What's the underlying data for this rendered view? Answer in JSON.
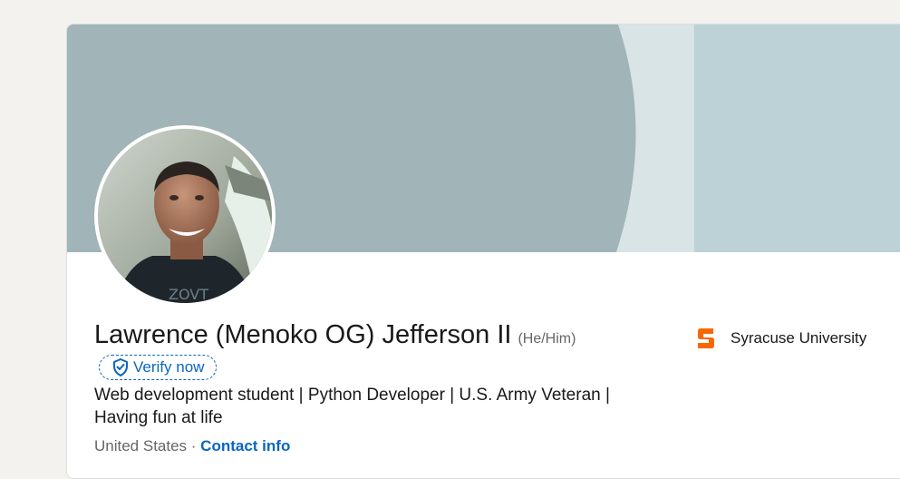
{
  "profile": {
    "name": "Lawrence (Menoko OG) Jefferson II",
    "pronouns": "(He/Him)",
    "verify_label": "Verify now",
    "headline": "Web development student | Python Developer | U.S. Army Veteran | Having fun at life",
    "location": "United States",
    "separator": " · ",
    "contact_label": "Contact info"
  },
  "education": {
    "school_name": "Syracuse University",
    "logo_icon": "syracuse-s-icon"
  },
  "colors": {
    "banner_dark": "#a1b4b7",
    "banner_light": "#d8e4e6",
    "banner_right": "#bcd2d6",
    "accent_blue": "#0a66c2",
    "syracuse_orange": "#f76900"
  }
}
